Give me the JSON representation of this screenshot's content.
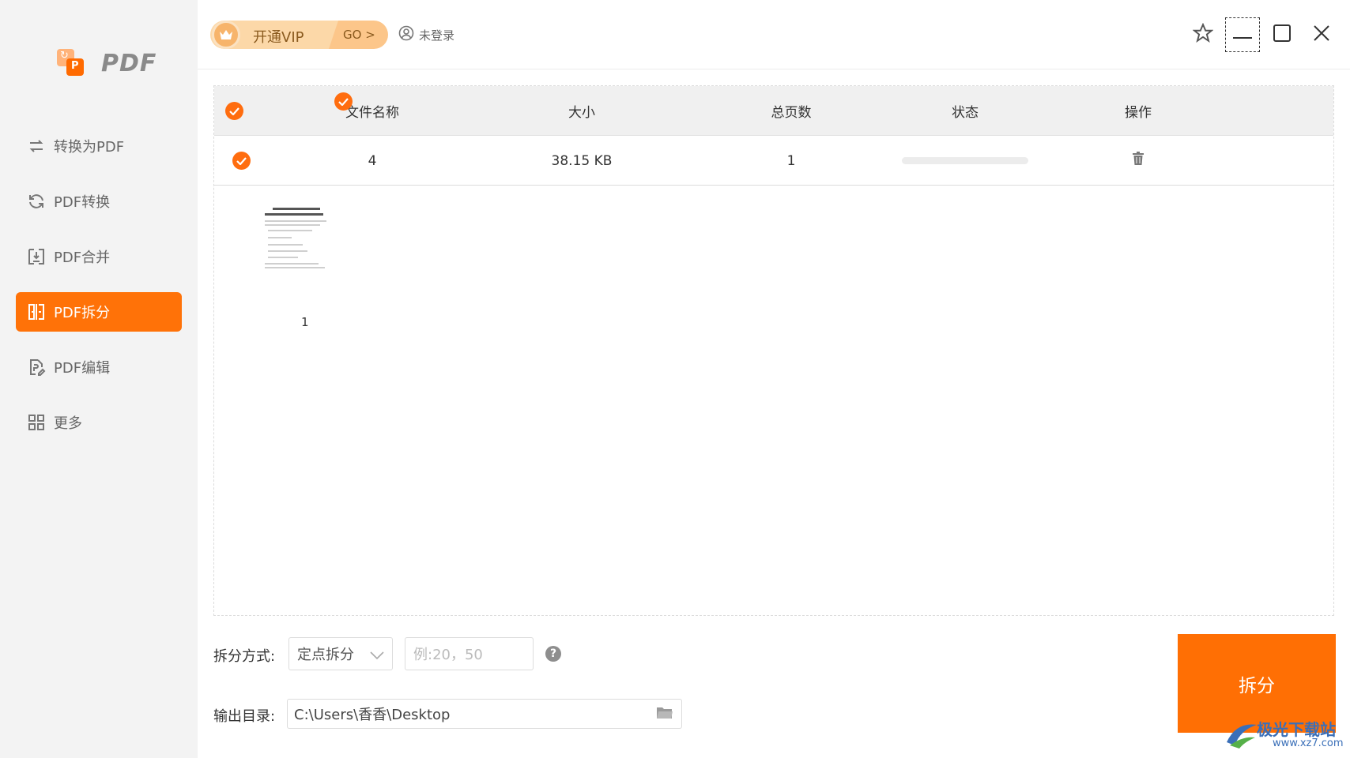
{
  "app": {
    "logo_text": "PDF"
  },
  "sidebar": {
    "items": [
      {
        "label": "转换为PDF",
        "icon": "convert-to-icon",
        "active": false
      },
      {
        "label": "PDF转换",
        "icon": "refresh-icon",
        "active": false
      },
      {
        "label": "PDF合并",
        "icon": "merge-icon",
        "active": false
      },
      {
        "label": "PDF拆分",
        "icon": "split-icon",
        "active": true
      },
      {
        "label": "PDF编辑",
        "icon": "edit-doc-icon",
        "active": false
      },
      {
        "label": "更多",
        "icon": "grid-icon",
        "active": false
      }
    ]
  },
  "topbar": {
    "vip_label": "开通VIP",
    "vip_go": "GO >",
    "login_label": "未登录"
  },
  "table": {
    "headers": {
      "name": "文件名称",
      "size": "大小",
      "pages": "总页数",
      "status": "状态",
      "action": "操作"
    },
    "rows": [
      {
        "name": "4",
        "size": "38.15 KB",
        "pages": "1",
        "progress": 0
      }
    ]
  },
  "thumbnail": {
    "page_number": "1"
  },
  "controls": {
    "split_mode_label": "拆分方式:",
    "split_mode_value": "定点拆分",
    "split_points_placeholder": "例:20，50",
    "help_glyph": "?",
    "output_label": "输出目录:",
    "output_path": "C:\\Users\\香香\\Desktop",
    "split_button": "拆分"
  },
  "watermark": {
    "name": "极光下载站",
    "url": "www.xz7.com"
  },
  "colors": {
    "accent": "#ff7208",
    "sidebar_bg": "#f3f3f3",
    "header_bg": "#f0f0f0"
  }
}
